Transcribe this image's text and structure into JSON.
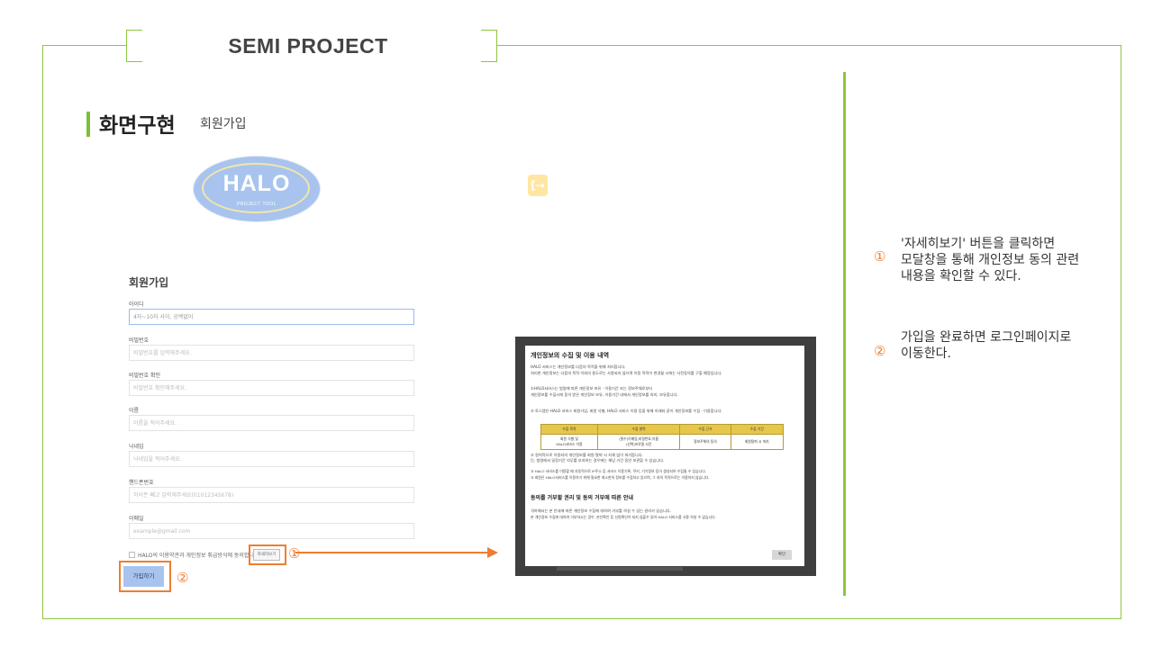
{
  "slide": {
    "header_title": "SEMI PROJECT",
    "section_title": "화면구현",
    "section_subtitle": "회원가입"
  },
  "logo": {
    "text": "HALO",
    "subtext": "PROJECT TOOL"
  },
  "login_icon": {
    "glyph": "[→"
  },
  "signup_form": {
    "title": "회원가입",
    "fields": [
      {
        "label": "아이디",
        "placeholder": "4자~10자 사이, 공백없이"
      },
      {
        "label": "비밀번호",
        "placeholder": "비밀번호를 입력해주세요."
      },
      {
        "label": "비밀번호 확인",
        "placeholder": "비밀번호 확인해주세요."
      },
      {
        "label": "이름",
        "placeholder": "이름을 적어주세요."
      },
      {
        "label": "닉네임",
        "placeholder": "닉네임을 적어주세요."
      },
      {
        "label": "핸드폰번호",
        "placeholder": "하이픈 빼고 입력해주세요(01012345678)"
      },
      {
        "label": "이메일",
        "placeholder": "example@gmail.com"
      }
    ],
    "agree_text": "HALO의 이용약관과 개인정보 취급방식에 동의합니다.",
    "detail_button": "자세히보기",
    "submit_button": "가입하기",
    "mark_1": "①",
    "mark_2": "②"
  },
  "modal": {
    "title": "개인정보의 수집 및 이용 내역",
    "lines_1": [
      "HALO 서비스는 개인정보를 다음의 목적을 위해 처리합니다.",
      "처리한 개인정보는 다음의 목적 이외의 용도로는 사용되지 않으며 이용 목적이 변경될 시에는 사전동의를 구할 예정입니다."
    ],
    "lines_2": [
      "①HALO서비스는 법령에 따른 개인정보 보유 · 이용기간 또는 정보주체로부터",
      "개인정보를 수집시에 동의 받은 개인정보 보유, 이용기간 내에서 개인정보를 처리, 보유합니다."
    ],
    "line_3": "② 토스랩은 HALO 서비스 회원가입, 회원 식별, HALO 서비스 이용 등을 위해 아래와 같이 개인정보를 수집 · 이용합니다.",
    "table": {
      "headers": [
        "수집 목적",
        "수집 항목",
        "수집 근거",
        "수집 기간"
      ],
      "row": [
        "회원 식별 및\nHALO서비스 이용",
        "(필수)이메일,비밀번호,이름\n(선택)프로필 사진",
        "정보주체의 동의",
        "회원탈퇴 시 까지"
      ]
    },
    "lines_4": [
      "② 원칙적으로 이용자의 개인정보를 회원 탈퇴 시 지체 없이 파기합니다.",
      "단, 법령에서 일정기간 의무를 부과하는 경우에는 해당 기간 동안 보관할 수 있습니다."
    ],
    "lines_5": [
      "③ HALO 서비스를 이용할 때 자동적으로 IP주소 등 서비스 이용기록, 쿠키, 기기정보 등이 생성되어 수집될 수 있습니다.",
      "③ 회원은 HALO서비스를 이용하기 위해 필요한 최소한의 정보를 수집하고 있으며, 그 외의 목적으로는 이용하지 않습니다."
    ],
    "h2": "동의를 거부할 권리 및 동의 거부에 따른 안내",
    "lines_6": [
      "귀하께서는 본 안내에 따른 개인정보 수집에 대하여 거부를 하실 수 있는 권리가 있습니다.",
      "본 개인정보 수집에 대하여 거부하시는 경우, 본인확인 등 신원확인이 되지 않을수 있어 HALO 서비스를 사용 하실 수 없습니다."
    ],
    "ok_button": "확인"
  },
  "descriptions": [
    {
      "num": "①",
      "text": "'자세히보기' 버튼을 클릭하면\n모달창을 통해 개인정보 동의 관련\n내용을 확인할 수 있다."
    },
    {
      "num": "②",
      "text": "가입을 완료하면 로그인페이지로\n이동한다."
    }
  ],
  "colors": {
    "frame_green": "#8cc63f",
    "highlight_orange": "#ef7d31",
    "logo_blue": "#a8c4ee",
    "login_icon_yellow": "#ffe7a3"
  }
}
